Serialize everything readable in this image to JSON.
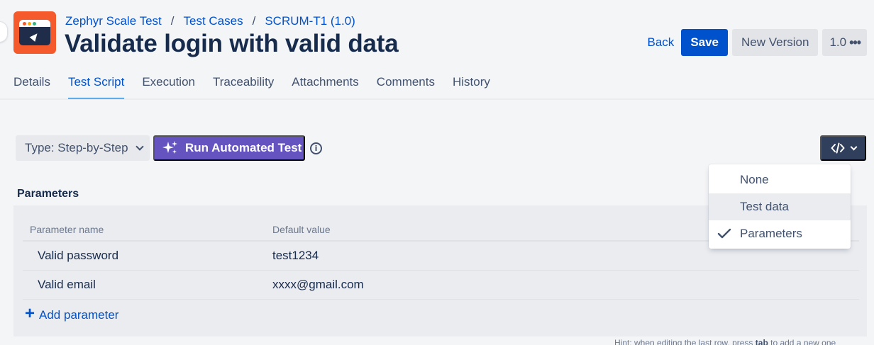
{
  "breadcrumb": {
    "project": "Zephyr Scale Test",
    "section": "Test Cases",
    "key": "SCRUM-T1 (1.0)",
    "separator": "/"
  },
  "title": "Validate login with valid data",
  "header_actions": {
    "back": "Back",
    "save": "Save",
    "new_version": "New Version",
    "version": "1.0"
  },
  "tabs": [
    {
      "label": "Details",
      "active": false
    },
    {
      "label": "Test Script",
      "active": true
    },
    {
      "label": "Execution",
      "active": false
    },
    {
      "label": "Traceability",
      "active": false
    },
    {
      "label": "Attachments",
      "active": false
    },
    {
      "label": "Comments",
      "active": false
    },
    {
      "label": "History",
      "active": false
    }
  ],
  "toolbar": {
    "type_select": "Type: Step-by-Step",
    "run_automated": "Run Automated Test",
    "info_icon": "info-icon",
    "code_icon": "code-icon"
  },
  "parameters": {
    "title": "Parameters",
    "columns": [
      "Parameter name",
      "Default value"
    ],
    "rows": [
      [
        "Valid password",
        "test1234"
      ],
      [
        "Valid email",
        "xxxx@gmail.com"
      ]
    ],
    "add_label": "Add parameter",
    "hint_prefix": "Hint: when editing the last row, press ",
    "hint_key": "tab",
    "hint_suffix": " to add a new one"
  },
  "dropdown": {
    "items": [
      {
        "label": "None",
        "selected": false,
        "hovered": false
      },
      {
        "label": "Test data",
        "selected": false,
        "hovered": true
      },
      {
        "label": "Parameters",
        "selected": true,
        "hovered": false
      }
    ]
  },
  "colors": {
    "primary": "#0052cc",
    "automation": "#6554c0",
    "logo": "#f45a2c",
    "code_button": "#2f3f5c"
  }
}
